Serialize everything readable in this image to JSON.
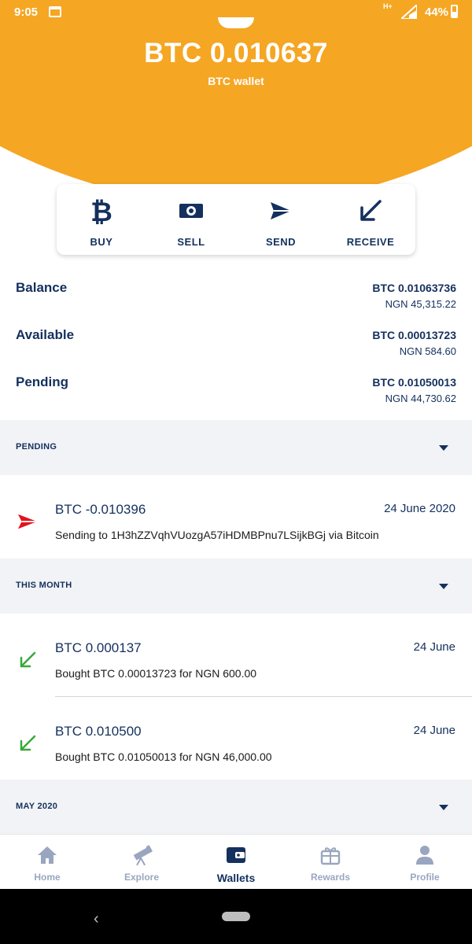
{
  "status_bar": {
    "time": "9:05",
    "network": "H+",
    "battery": "44%"
  },
  "header": {
    "amount": "BTC 0.010637",
    "subtitle": "BTC wallet",
    "bg_color": "#f5a623"
  },
  "actions": [
    {
      "label": "BUY",
      "icon": "bitcoin-icon"
    },
    {
      "label": "SELL",
      "icon": "banknote-icon"
    },
    {
      "label": "SEND",
      "icon": "send-arrow-icon"
    },
    {
      "label": "RECEIVE",
      "icon": "receive-arrow-icon"
    }
  ],
  "balances": [
    {
      "name": "Balance",
      "btc": "BTC 0.01063736",
      "ngn": "NGN 45,315.22"
    },
    {
      "name": "Available",
      "btc": "BTC 0.00013723",
      "ngn": "NGN 584.60"
    },
    {
      "name": "Pending",
      "btc": "BTC 0.01050013",
      "ngn": "NGN 44,730.62"
    }
  ],
  "sections": {
    "pending": {
      "title": "PENDING",
      "transactions": [
        {
          "amount": "BTC -0.010396",
          "date": "24 June 2020",
          "description": "Sending to 1H3hZZVqhVUozgA57iHDMBPnu7LSijkBGj via Bitcoin",
          "icon": "send-arrow-icon",
          "color": "#e0141e"
        }
      ]
    },
    "this_month": {
      "title": "THIS MONTH",
      "transactions": [
        {
          "amount": "BTC 0.000137",
          "date": "24 June",
          "description": "Bought BTC 0.00013723 for NGN 600.00",
          "icon": "receive-arrow-icon",
          "color": "#3aa83a"
        },
        {
          "amount": "BTC 0.010500",
          "date": "24 June",
          "description": "Bought BTC 0.01050013 for NGN 46,000.00",
          "icon": "receive-arrow-icon",
          "color": "#3aa83a"
        }
      ]
    },
    "may_2020": {
      "title": "MAY 2020"
    }
  },
  "bottom_nav": [
    {
      "label": "Home",
      "icon": "home-icon",
      "active": false
    },
    {
      "label": "Explore",
      "icon": "telescope-icon",
      "active": false
    },
    {
      "label": "Wallets",
      "icon": "wallet-icon",
      "active": true
    },
    {
      "label": "Rewards",
      "icon": "gift-icon",
      "active": false
    },
    {
      "label": "Profile",
      "icon": "person-icon",
      "active": false
    }
  ],
  "colors": {
    "navy": "#14305e",
    "orange": "#f5a623",
    "muted": "#9aa6bf",
    "section_bg": "#f2f3f6"
  }
}
